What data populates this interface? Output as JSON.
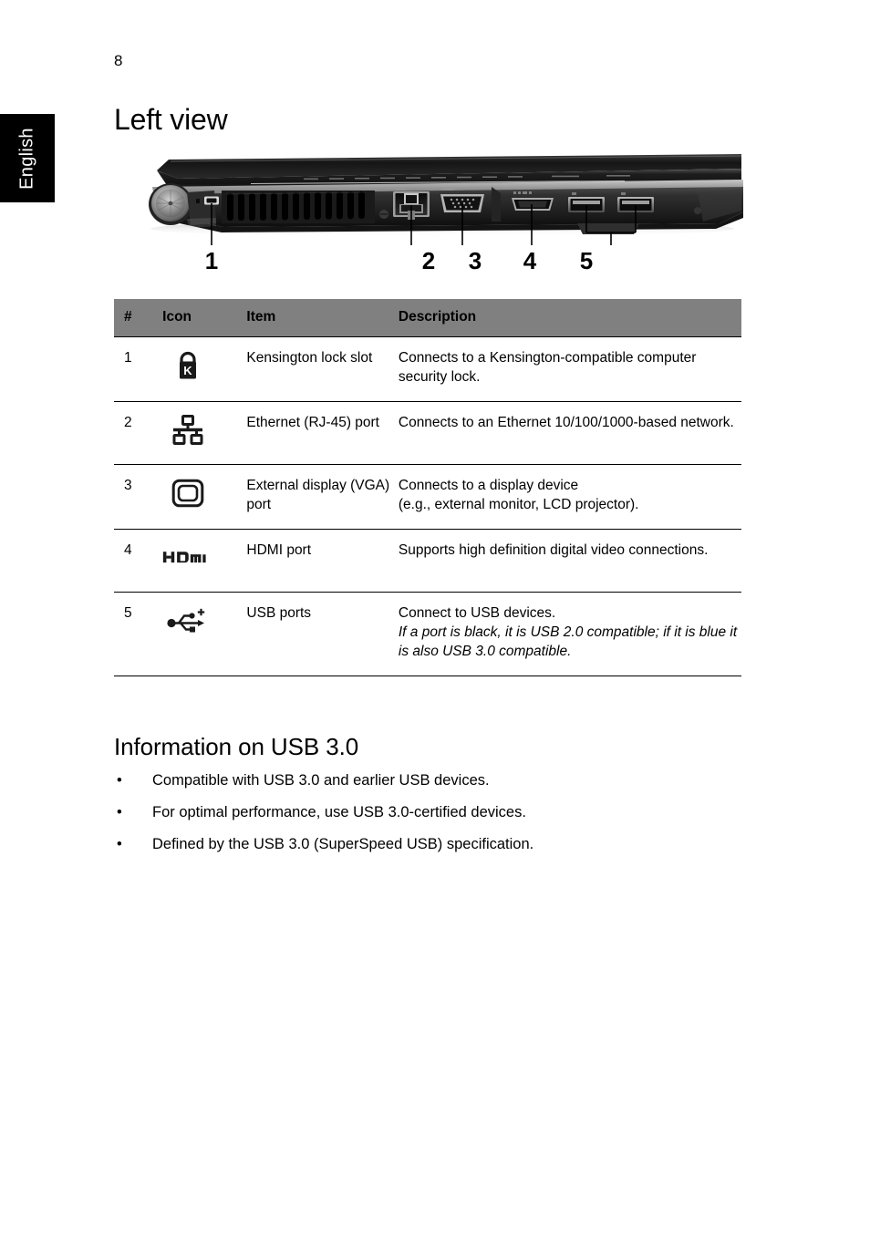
{
  "page": {
    "number": "8",
    "language_tab": "English",
    "title": "Left view"
  },
  "figure": {
    "name": "laptop-left-side-view",
    "alt": "Left side view of notebook computer showing ports",
    "callouts": [
      {
        "label": "1",
        "target": "Kensington lock slot"
      },
      {
        "label": "2",
        "target": "Ethernet (RJ-45) port"
      },
      {
        "label": "3",
        "target": "External display (VGA) port"
      },
      {
        "label": "4",
        "target": "HDMI port"
      },
      {
        "label": "5",
        "target": "USB ports"
      }
    ]
  },
  "table": {
    "headers": {
      "num": "#",
      "icon": "Icon",
      "item": "Item",
      "description": "Description"
    },
    "header_bg": "#808080",
    "rows": [
      {
        "num": "1",
        "icon_name": "kensington-lock-icon",
        "item": "Kensington lock slot",
        "desc_lines": [
          "Connects to a Kensington-compatible computer security lock."
        ],
        "desc_italic_lines": []
      },
      {
        "num": "2",
        "icon_name": "ethernet-rj45-icon",
        "item": "Ethernet (RJ-45) port",
        "desc_lines": [
          "Connects to an Ethernet 10/100/1000-based network."
        ],
        "desc_italic_lines": []
      },
      {
        "num": "3",
        "icon_name": "external-display-vga-icon",
        "item": "External display (VGA) port",
        "desc_lines": [
          "Connects to a display device",
          "(e.g., external monitor, LCD projector)."
        ],
        "desc_italic_lines": []
      },
      {
        "num": "4",
        "icon_name": "hdmi-icon",
        "item": "HDMI port",
        "desc_lines": [
          "Supports high definition digital video connections."
        ],
        "desc_italic_lines": []
      },
      {
        "num": "5",
        "icon_name": "usb-superspeed-icon",
        "item": "USB ports",
        "desc_lines": [
          "Connect to USB devices."
        ],
        "desc_italic_lines": [
          "If a port is black, it is USB 2.0 compatible; if it is blue it is also USB 3.0 compatible."
        ]
      }
    ]
  },
  "usb_section": {
    "title": "Information on USB 3.0",
    "bullet_char": "•",
    "bullets": [
      "Compatible with USB 3.0 and earlier USB devices.",
      "For optimal performance, use USB 3.0-certified devices.",
      "Defined by the USB 3.0 (SuperSpeed USB) specification."
    ]
  }
}
